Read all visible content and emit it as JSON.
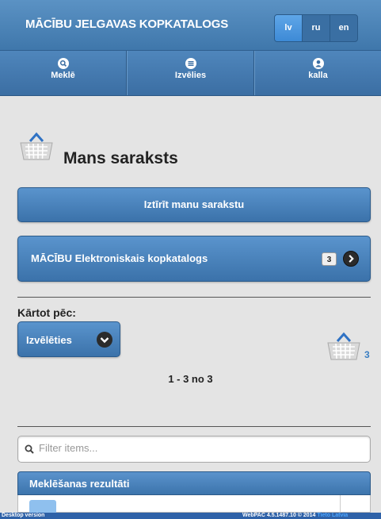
{
  "header": {
    "title": "MĀCĪBU JELGAVAS KOPKATALOGS",
    "languages": [
      {
        "label": "lv",
        "active": true
      },
      {
        "label": "ru",
        "active": false
      },
      {
        "label": "en",
        "active": false
      }
    ]
  },
  "nav": {
    "items": [
      {
        "label": "Meklē",
        "icon": "search-icon"
      },
      {
        "label": "Izvēlies",
        "icon": "list-icon"
      },
      {
        "label": "kalla",
        "icon": "user-icon"
      }
    ]
  },
  "page": {
    "title": "Mans saraksts",
    "clear_label": "Iztīrīt manu sarakstu",
    "catalog_label": "MĀCĪBU Elektroniskais kopkatalogs",
    "catalog_count": "3",
    "sort_label": "Kārtot pēc:",
    "sort_select": "Izvēlēties",
    "basket_count": "3",
    "pager": "1 - 3 no 3",
    "filter_placeholder": "Filter items...",
    "results_title": "Meklēšanas rezultāti"
  },
  "footer": {
    "desktop": "Desktop version",
    "version": "WebPAC 4.5.1487.10 © 2014",
    "vendor": "Tieto Latvia"
  },
  "colors": {
    "accent": "#3f77ab",
    "count_link": "#3a7ec2"
  }
}
